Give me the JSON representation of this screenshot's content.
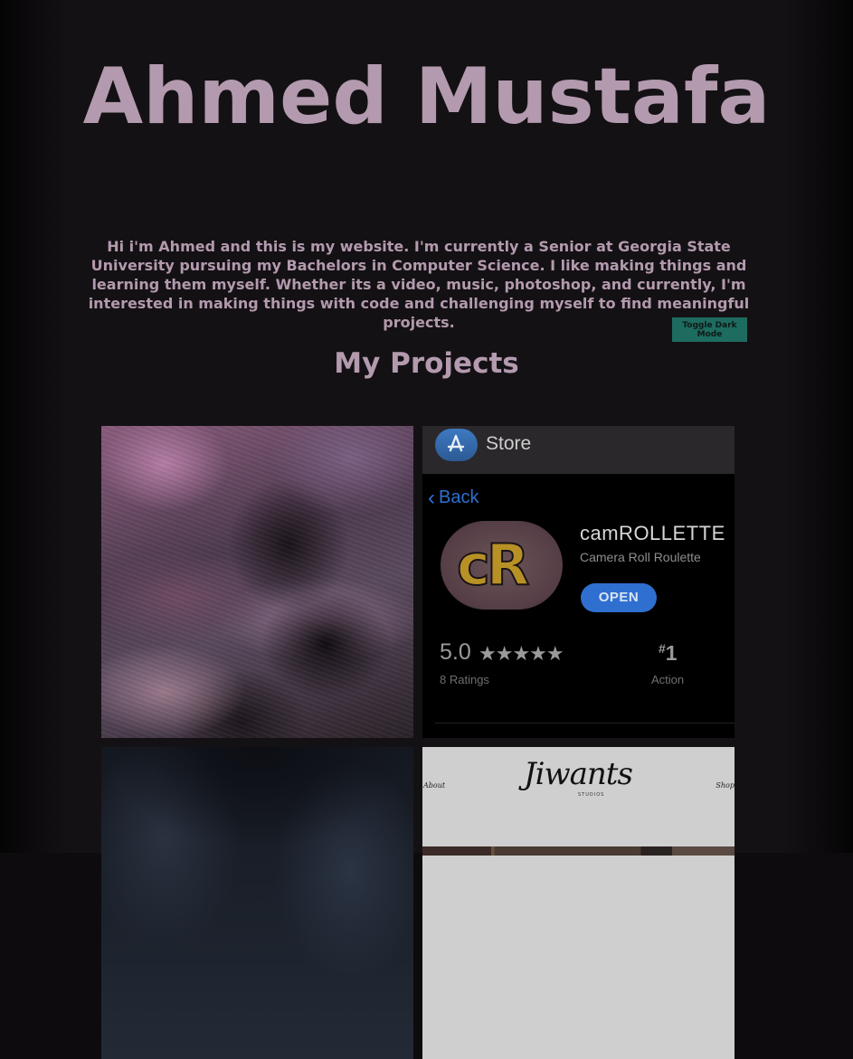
{
  "header": {
    "title": "Ahmed Mustafa"
  },
  "bio": {
    "text": "Hi i'm Ahmed and this is my website. I'm currently a Senior at Georgia State University pursuing my Bachelors in Computer Science. I like making things and learning them myself. Whether its a video, music, photoshop, and currently, I'm interested in making things with code and challenging myself to find meaningful projects."
  },
  "controls": {
    "toggle_dark_mode_label": "Toggle Dark Mode"
  },
  "projects": {
    "heading": "My Projects",
    "tiles": [
      {
        "kind": "abstract-art"
      },
      {
        "kind": "app-store-screenshot",
        "store_label": "Store",
        "back_label": "Back",
        "app_icon_text": "cR",
        "app_name": "camROLLETTE",
        "app_subtitle": "Camera Roll Roulette",
        "open_label": "OPEN",
        "rating_value": "5.0",
        "rating_stars": "★★★★★",
        "rating_count": "8 Ratings",
        "rank_hash": "#",
        "rank_number": "1",
        "rank_category": "Action"
      },
      {
        "kind": "dark-photo"
      },
      {
        "kind": "website-screenshot",
        "logo_text": "Jiwants",
        "logo_sub": "STUDIOS",
        "nav_left": "About",
        "nav_right": "Shop"
      }
    ]
  },
  "colors": {
    "background": "#0d0b0d",
    "text_accent": "#b39aae",
    "toggle_button": "#1e6b5f",
    "store_blue": "#2f6fd0"
  }
}
